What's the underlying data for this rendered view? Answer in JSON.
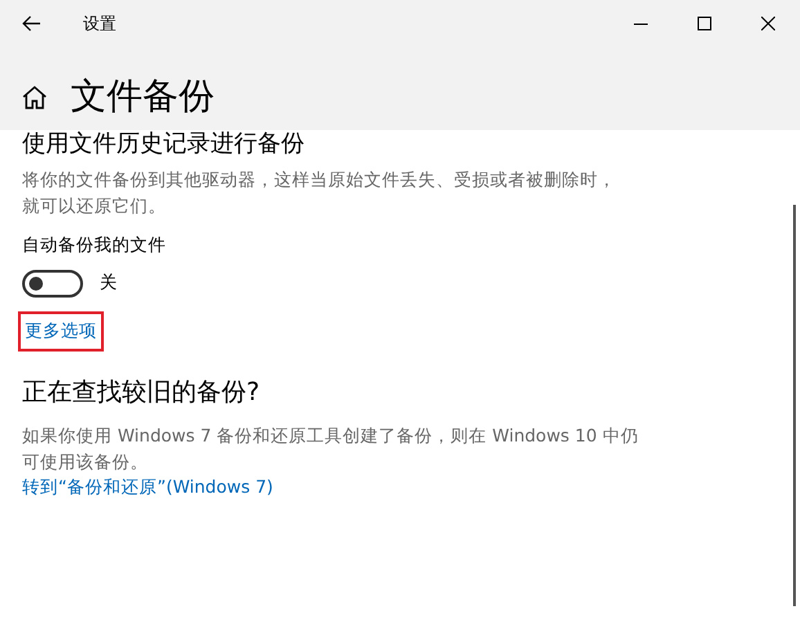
{
  "window": {
    "title": "设置"
  },
  "page_title": "文件备份",
  "section1": {
    "heading": "使用文件历史记录进行备份",
    "description": "将你的文件备份到其他驱动器，这样当原始文件丢失、受损或者被删除时，就可以还原它们。",
    "toggle": {
      "label": "自动备份我的文件",
      "on": false,
      "state_text": "关"
    },
    "link": {
      "text": "更多选项",
      "highlighted": true
    }
  },
  "section2": {
    "heading": "正在查找较旧的备份?",
    "description": "如果你使用 Windows 7 备份和还原工具创建了备份，则在 Windows 10 中仍可使用该备份。",
    "link": "转到“备份和还原”(Windows 7)"
  }
}
